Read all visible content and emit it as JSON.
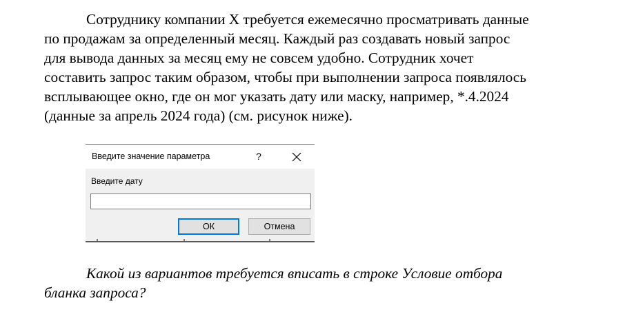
{
  "paragraph": {
    "lines": [
      "Сотруднику компании Х требуется ежемесячно просматривать данные",
      "по продажам за определенный месяц. Каждый раз создавать новый запрос",
      "для вывода данных за месяц ему не совсем удобно. Сотрудник хочет",
      "составить запрос таким образом, чтобы при выполнении запроса появлялось",
      "всплывающее окно, где он мог указать дату или маску, например, *.4.2024",
      "(данные за апрель 2024 года) (см. рисунок ниже)."
    ]
  },
  "dialog": {
    "title": "Введите значение параметра",
    "help_label": "?",
    "close_icon": "close-icon",
    "prompt": "Введите дату",
    "input_value": "",
    "ok_label": "ОК",
    "cancel_label": "Отмена",
    "accent_color": "#0078d7"
  },
  "question": {
    "lines": [
      "Какой из вариантов требуется вписать в строке Условие отбора",
      "бланка запроса?"
    ]
  }
}
